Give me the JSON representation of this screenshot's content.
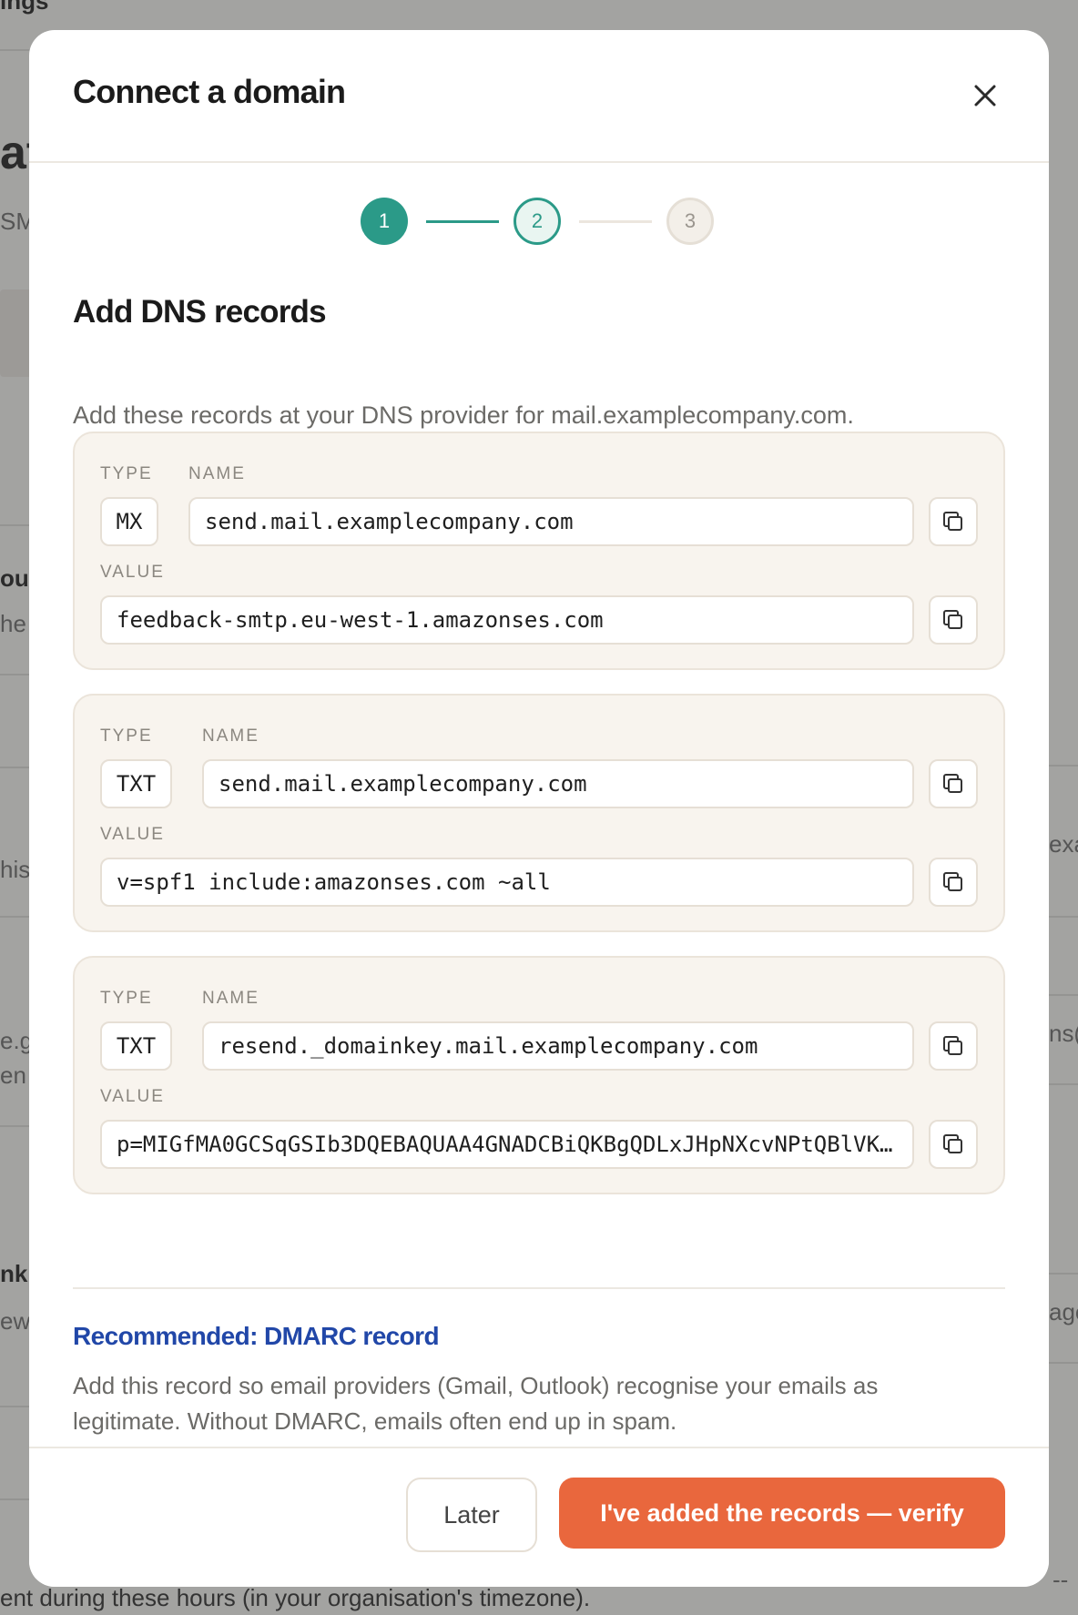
{
  "background": {
    "fragments": [
      "ings",
      "at",
      "SM",
      "ou",
      "he",
      "his",
      "e.g",
      "en",
      "nk",
      "ew",
      "exa",
      "ns(",
      "age",
      "--"
    ],
    "footer_text": "ent during these hours (in your organisation's timezone)."
  },
  "modal": {
    "title": "Connect a domain",
    "close_icon": "close-icon",
    "stepper": {
      "steps": [
        "1",
        "2",
        "3"
      ],
      "current": 2
    },
    "section_title": "Add DNS records",
    "section_desc": "Add these records at your DNS provider for mail.examplecompany.com.",
    "labels": {
      "type": "TYPE",
      "name": "NAME",
      "value": "VALUE"
    },
    "records": [
      {
        "type": "MX",
        "name": "send.mail.examplecompany.com",
        "value": "feedback-smtp.eu-west-1.amazonses.com"
      },
      {
        "type": "TXT",
        "name": "send.mail.examplecompany.com",
        "value": "v=spf1 include:amazonses.com ~all"
      },
      {
        "type": "TXT",
        "name": "resend._domainkey.mail.examplecompany.com",
        "value": "p=MIGfMA0GCSqGSIb3DQEBAQUAA4GNADCBiQKBgQDLxJHpNXcvNPtQBlVK…"
      }
    ],
    "dmarc": {
      "title": "Recommended: DMARC record",
      "desc": "Add this record so email providers (Gmail, Outlook) recognise your emails as legitimate. Without DMARC, emails often end up in spam."
    },
    "footer": {
      "later_label": "Later",
      "verify_label": "I've added the records — verify"
    }
  },
  "colors": {
    "accent_teal": "#2b9a88",
    "primary_orange": "#e9673d",
    "dmarc_blue": "#2147a8"
  }
}
